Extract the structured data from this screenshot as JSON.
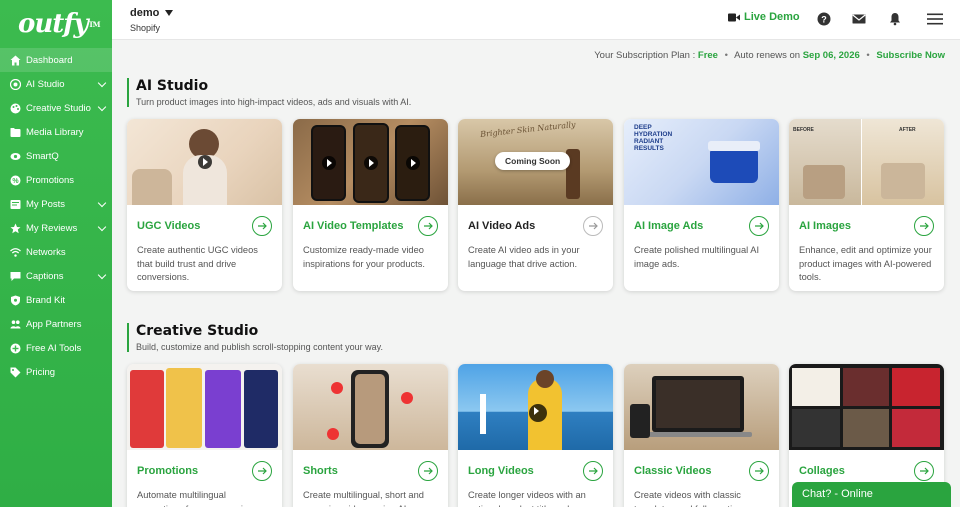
{
  "brand": {
    "logo": "outfy",
    "tm": "TM"
  },
  "sidebar": {
    "items": [
      {
        "label": "Dashboard",
        "icon": "dashboard-icon",
        "caret": false,
        "active": true
      },
      {
        "label": "AI Studio",
        "icon": "ai-studio-icon",
        "caret": true
      },
      {
        "label": "Creative Studio",
        "icon": "creative-studio-icon",
        "caret": true
      },
      {
        "label": "Media Library",
        "icon": "media-library-icon",
        "caret": false
      },
      {
        "label": "SmartQ",
        "icon": "smartq-icon",
        "caret": false
      },
      {
        "label": "Promotions",
        "icon": "promotions-icon",
        "caret": false
      },
      {
        "label": "My Posts",
        "icon": "posts-icon",
        "caret": true
      },
      {
        "label": "My Reviews",
        "icon": "star-icon",
        "caret": true
      },
      {
        "label": "Networks",
        "icon": "wifi-icon",
        "caret": false
      },
      {
        "label": "Captions",
        "icon": "chat-icon",
        "caret": true
      },
      {
        "label": "Brand Kit",
        "icon": "shield-icon",
        "caret": false
      },
      {
        "label": "App Partners",
        "icon": "partners-icon",
        "caret": false
      },
      {
        "label": "Free AI Tools",
        "icon": "plus-icon",
        "caret": false
      },
      {
        "label": "Pricing",
        "icon": "tag-icon",
        "caret": false
      }
    ]
  },
  "topbar": {
    "store_name": "demo",
    "store_platform": "Shopify",
    "live_demo": "Live Demo"
  },
  "subscription": {
    "prefix": "Your Subscription Plan : ",
    "plan": "Free",
    "renews_prefix": "Auto renews on ",
    "renew_date": "Sep 06, 2026",
    "subscribe": "Subscribe Now"
  },
  "ai_studio": {
    "title": "AI Studio",
    "subtitle": "Turn product images into high-impact videos, ads and visuals with AI.",
    "cards": [
      {
        "title": "UGC Videos",
        "desc": "Create authentic UGC videos that build trust and drive conversions."
      },
      {
        "title": "AI Video Templates",
        "desc": "Customize ready-made video inspirations for your products."
      },
      {
        "title": "AI Video Ads",
        "desc": "Create AI video ads in your language that drive action.",
        "badge": "Coming Soon",
        "img_text": "Brighter Skin Naturally"
      },
      {
        "title": "AI Image Ads",
        "desc": "Create polished multilingual AI image ads.",
        "img_text": "DEEP HYDRATION RADIANT RESULTS"
      },
      {
        "title": "AI Images",
        "desc": "Enhance, edit and optimize your product images with AI-powered tools.",
        "img_before": "BEFORE",
        "img_after": "AFTER"
      }
    ]
  },
  "creative_studio": {
    "title": "Creative Studio",
    "subtitle": "Build, customize and publish scroll-stopping content your way.",
    "cards": [
      {
        "title": "Promotions",
        "desc": "Automate multilingual promotions for any occasion"
      },
      {
        "title": "Shorts",
        "desc": "Create multilingual, short and engaging videos using AI-"
      },
      {
        "title": "Long Videos",
        "desc": "Create longer videos with an optional product title and"
      },
      {
        "title": "Classic Videos",
        "desc": "Create videos with classic templates and full creative"
      },
      {
        "title": "Collages",
        "desc": ""
      }
    ]
  },
  "chat": {
    "label": "Chat? - Online"
  },
  "colors": {
    "accent": "#2aa43f",
    "sidebar": "#3cbb4f"
  }
}
